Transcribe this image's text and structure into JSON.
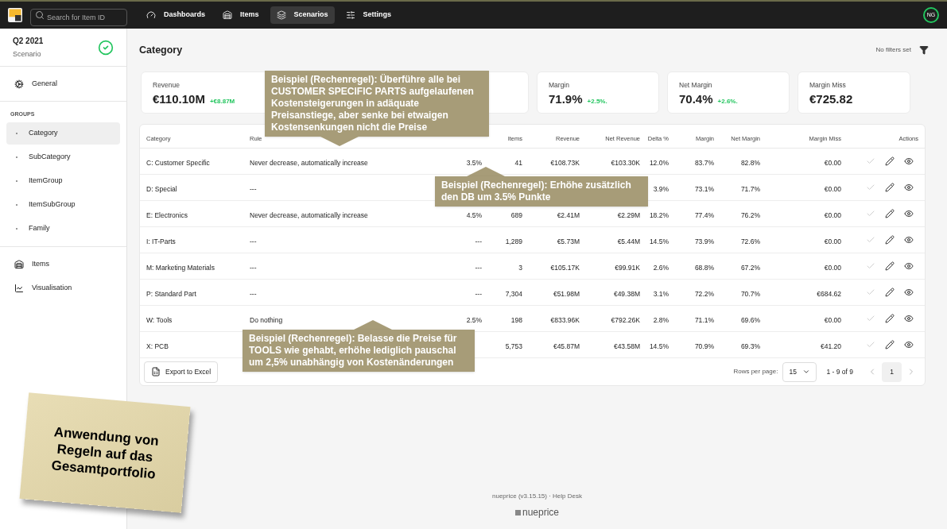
{
  "topbar": {
    "search": {
      "placeholder": "Search for Item ID"
    },
    "nav": [
      {
        "label": "Dashboards",
        "selected": false
      },
      {
        "label": "Items",
        "selected": false
      },
      {
        "label": "Scenarios",
        "selected": true
      },
      {
        "label": "Settings",
        "selected": false
      }
    ],
    "avatar": "NG"
  },
  "sidebar": {
    "title": "Q2 2021",
    "subtitle": "Scenario",
    "approved": true,
    "general": "General",
    "groups_heading": "GROUPS",
    "groups": [
      {
        "label": "Category",
        "selected": true
      },
      {
        "label": "SubCategory",
        "selected": false
      },
      {
        "label": "ItemGroup",
        "selected": false
      },
      {
        "label": "ItemSubGroup",
        "selected": false
      },
      {
        "label": "Family",
        "selected": false
      }
    ],
    "bottom": [
      {
        "label": "Items"
      },
      {
        "label": "Visualisation"
      }
    ]
  },
  "page": {
    "title": "Category",
    "filters": "No filters set"
  },
  "kpis": [
    {
      "kind": "metric",
      "label": "Revenue",
      "value": "€110.10M",
      "delta": "+€8.87M"
    },
    {
      "kind": "covered"
    },
    {
      "kind": "metric",
      "label": "Margin",
      "value": "71.9%",
      "delta": "+2.5%."
    },
    {
      "kind": "metric",
      "label": "Net Margin",
      "value": "70.4%",
      "delta": "+2.6%."
    },
    {
      "kind": "metric",
      "label": "Margin Miss",
      "value": "€725.82"
    }
  ],
  "table": {
    "columns": [
      "Category",
      "Rule",
      null,
      "Items",
      "Revenue",
      "Net Revenue",
      "Delta %",
      "Margin",
      "Net Margin",
      "Margin Miss",
      "Actions"
    ],
    "rows": [
      {
        "cells": [
          "C: Customer Specific",
          "Never decrease, automatically increase",
          "3.5%",
          "41",
          "€108.73K",
          "€103.30K",
          "12.0%",
          "83.7%",
          "82.8%",
          "€0.00"
        ]
      },
      {
        "cells": [
          "D: Special",
          "---",
          null,
          null,
          null,
          null,
          "3.9%",
          "73.1%",
          "71.7%",
          "€0.00"
        ]
      },
      {
        "cells": [
          "E: Electronics",
          "Never decrease, automatically increase",
          "4.5%",
          "689",
          "€2.41M",
          "€2.29M",
          "18.2%",
          "77.4%",
          "76.2%",
          "€0.00"
        ]
      },
      {
        "cells": [
          "I: IT-Parts",
          "---",
          "---",
          "1,289",
          "€5.73M",
          "€5.44M",
          "14.5%",
          "73.9%",
          "72.6%",
          "€0.00"
        ]
      },
      {
        "cells": [
          "M: Marketing Materials",
          "---",
          "---",
          "3",
          "€105.17K",
          "€99.91K",
          "2.6%",
          "68.8%",
          "67.2%",
          "€0.00"
        ]
      },
      {
        "cells": [
          "P: Standard Part",
          "---",
          "---",
          "7,304",
          "€51.98M",
          "€49.38M",
          "3.1%",
          "72.2%",
          "70.7%",
          "€684.62"
        ]
      },
      {
        "cells": [
          "W: Tools",
          "Do nothing",
          "2.5%",
          "198",
          "€833.96K",
          "€792.26K",
          "2.8%",
          "71.1%",
          "69.6%",
          "€0.00"
        ]
      },
      {
        "cells": [
          "X: PCB",
          null,
          null,
          "5,753",
          "€45.87M",
          "€43.58M",
          "14.5%",
          "70.9%",
          "69.3%",
          "€41.20"
        ]
      }
    ],
    "export": "Export to Excel",
    "rows_per_page_label": "Rows per page:",
    "rows_per_page": "15",
    "range": "1 - 9 of 9",
    "page": "1"
  },
  "callouts": [
    {
      "text": "Beispiel (Rechenregel): Überführe alle bei CUSTOMER SPECIFIC PARTS aufgelaufenen Kostensteigerungen in adäquate Preisanstiege, aber senke bei etwaigen Kostensenkungen nicht die Preise"
    },
    {
      "text": "Beispiel (Rechenregel): Erhöhe zusätzlich den DB um 3.5% Punkte"
    },
    {
      "text": "Beispiel (Rechenregel): Belasse die Preise für TOOLS wie gehabt, erhöhe lediglich pauschal um 2,5% unabhängig von Kostenänderungen"
    }
  ],
  "sticky_note": "Anwendung von Regeln auf das Gesamtportfolio",
  "footer": {
    "text": "nueprice (v3.15.15) · Help Desk",
    "logo": "nueprice"
  }
}
